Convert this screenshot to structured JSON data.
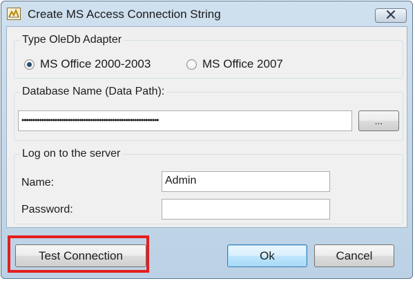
{
  "window": {
    "title": "Create MS Access Connection String",
    "close_icon": "close-icon",
    "app_icon": "access-app-icon"
  },
  "adapter_group": {
    "title": "Type OleDb Adapter",
    "options": [
      {
        "label": "MS Office 2000-2003",
        "checked": true
      },
      {
        "label": "MS Office 2007",
        "checked": false
      }
    ]
  },
  "database_group": {
    "title": "Database Name (Data Path):",
    "path_value": "••••••••••••••••••••••••••••••••••••••••••••••••••••••••••••••",
    "browse_label": "..."
  },
  "logon_group": {
    "title": "Log on to the server",
    "name_label": "Name:",
    "name_value": "Admin",
    "password_label": "Password:",
    "password_value": ""
  },
  "buttons": {
    "test_connection": "Test Connection",
    "ok": "Ok",
    "cancel": "Cancel"
  },
  "colors": {
    "highlight": "#e41e1e",
    "window_frame": "#bcd1e5",
    "default_button": "#bee6fd"
  }
}
